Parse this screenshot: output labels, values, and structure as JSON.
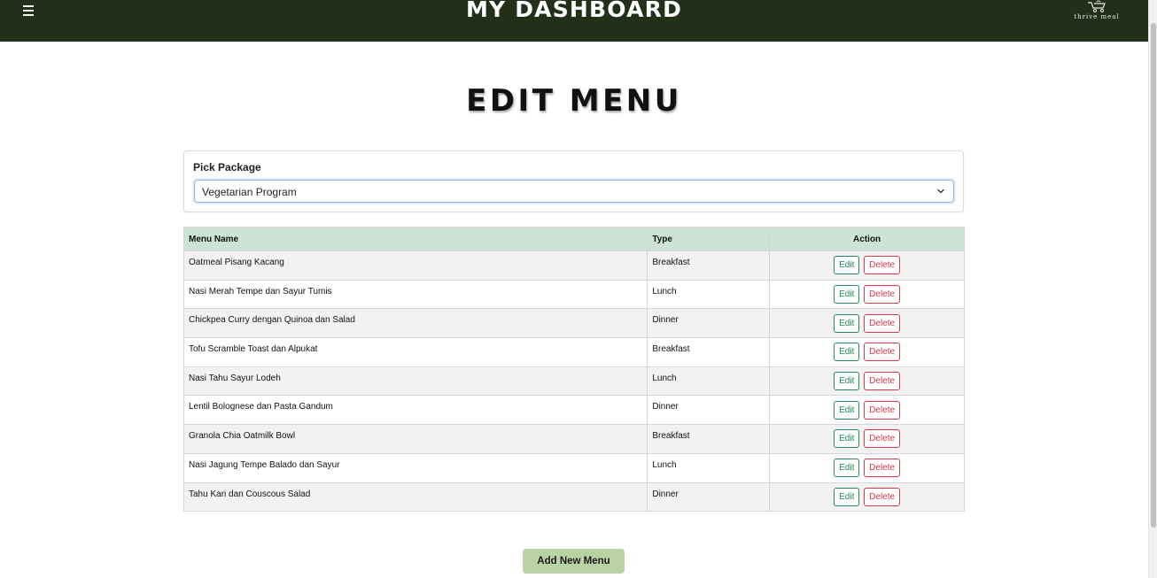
{
  "header": {
    "title": "MY DASHBOARD",
    "logo_text": "thrive meal",
    "menu_icon": "hamburger-icon"
  },
  "page": {
    "title": "EDIT MENU"
  },
  "package": {
    "label": "Pick Package",
    "selected": "Vegetarian Program"
  },
  "table": {
    "headers": {
      "name": "Menu Name",
      "type": "Type",
      "action": "Action"
    },
    "edit_label": "Edit",
    "delete_label": "Delete",
    "rows": [
      {
        "name": "Oatmeal Pisang Kacang",
        "type": "Breakfast"
      },
      {
        "name": "Nasi Merah Tempe dan Sayur Tumis",
        "type": "Lunch"
      },
      {
        "name": "Chickpea Curry dengan Quinoa dan Salad",
        "type": "Dinner"
      },
      {
        "name": "Tofu Scramble Toast dan Alpukat",
        "type": "Breakfast"
      },
      {
        "name": "Nasi Tahu Sayur Lodeh",
        "type": "Lunch"
      },
      {
        "name": "Lentil Bolognese dan Pasta Gandum",
        "type": "Dinner"
      },
      {
        "name": "Granola Chia Oatmilk Bowl",
        "type": "Breakfast"
      },
      {
        "name": "Nasi Jagung Tempe Balado dan Sayur",
        "type": "Lunch"
      },
      {
        "name": "Tahu Kari dan Couscous Salad",
        "type": "Dinner"
      }
    ]
  },
  "actions": {
    "add_label": "Add New Menu"
  },
  "colors": {
    "topbar": "#22301a",
    "table_header": "#cde3d6",
    "edit": "#1f8a5a",
    "delete": "#d33a4a",
    "add_button": "#b9d3a4"
  }
}
